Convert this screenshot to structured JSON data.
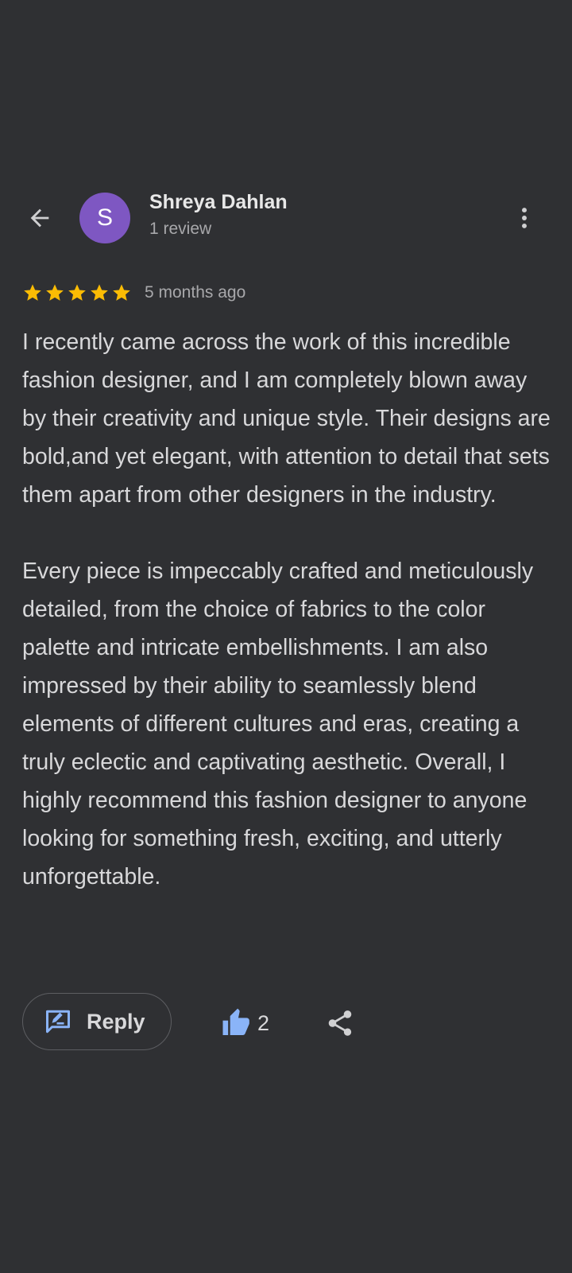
{
  "reviewer": {
    "name": "Shreya Dahlan",
    "review_count": "1 review",
    "avatar_initial": "S",
    "avatar_color": "#7e57c2"
  },
  "review": {
    "rating": 5,
    "max_rating": 5,
    "time_ago": "5 months ago",
    "paragraphs": [
      "I recently came across the work of this incredible fashion designer, and I am completely blown away by their creativity and unique style. Their designs are bold,and yet elegant, with attention to detail that sets them apart from other designers in the industry.",
      "Every piece is impeccably crafted and meticulously detailed, from the choice of fabrics to the color palette and intricate embellishments. I am also impressed by their ability to seamlessly blend elements of different cultures and eras, creating a truly eclectic and captivating aesthetic. Overall, I highly recommend this fashion designer to anyone looking for something fresh, exciting, and utterly unforgettable."
    ]
  },
  "actions": {
    "reply_label": "Reply",
    "like_count": "2"
  },
  "icons": {
    "back": "arrow-left-icon",
    "more": "more-vert-icon",
    "star": "star-icon",
    "reply": "reply-icon",
    "like": "thumb-up-icon",
    "share": "share-icon"
  },
  "colors": {
    "background": "#2f3033",
    "star": "#fbbc04",
    "accent_blue": "#8ab4f8"
  }
}
